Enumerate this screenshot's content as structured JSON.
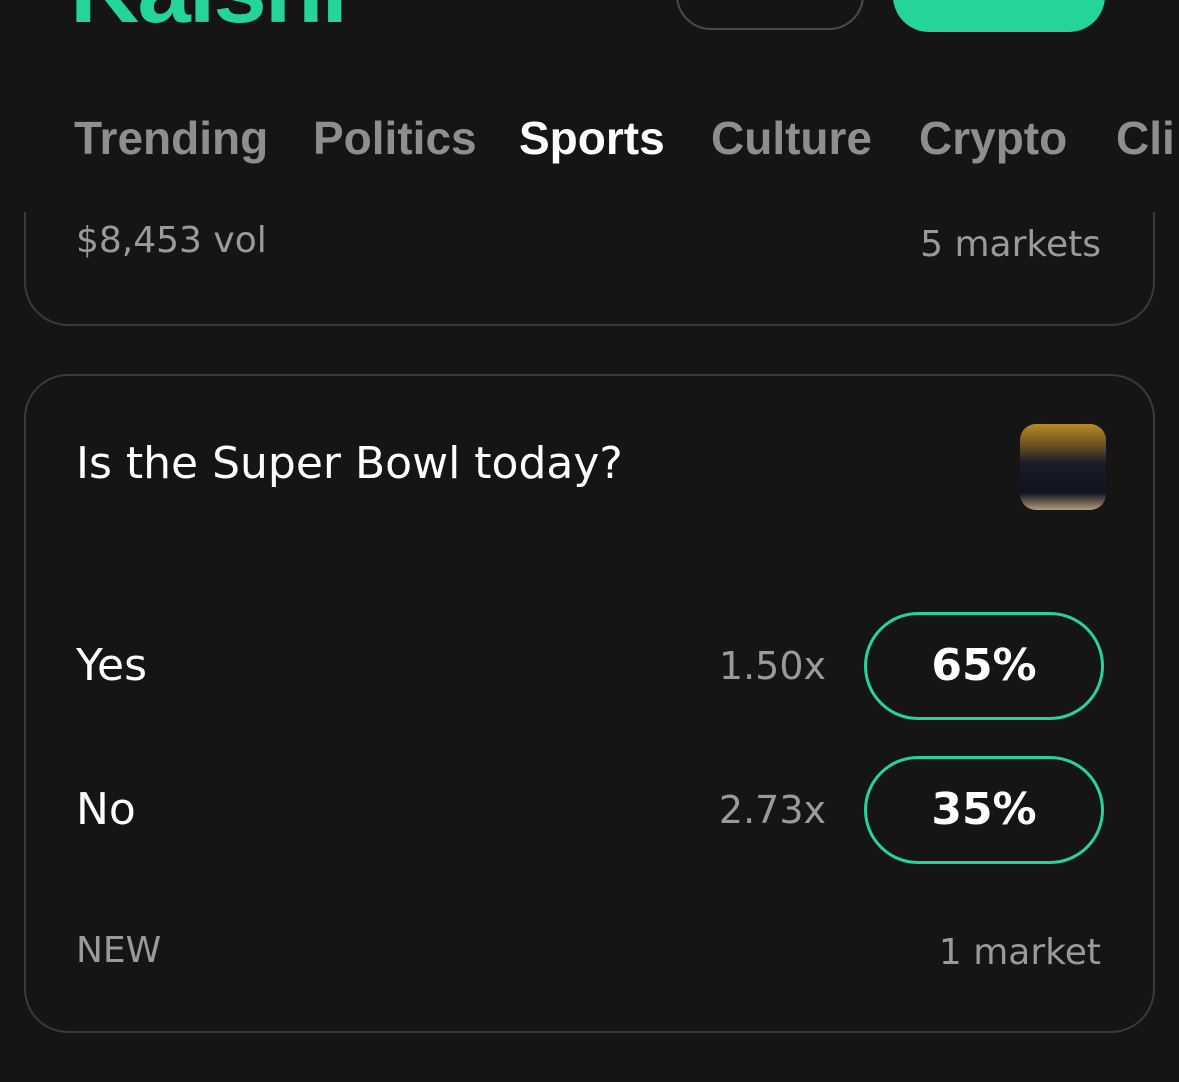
{
  "header": {
    "logo": "Kalshi"
  },
  "nav": {
    "tabs": [
      {
        "label": "Trending",
        "active": false
      },
      {
        "label": "Politics",
        "active": false
      },
      {
        "label": "Sports",
        "active": true
      },
      {
        "label": "Culture",
        "active": false
      },
      {
        "label": "Crypto",
        "active": false
      },
      {
        "label": "Cli",
        "active": false
      }
    ]
  },
  "prev_card": {
    "volume": "$8,453 vol",
    "markets": "5 markets"
  },
  "card": {
    "question": "Is the Super Bowl today?",
    "outcomes": [
      {
        "label": "Yes",
        "multiplier": "1.50x",
        "percent": "65%"
      },
      {
        "label": "No",
        "multiplier": "2.73x",
        "percent": "35%"
      }
    ],
    "status": "NEW",
    "markets": "1 market"
  },
  "colors": {
    "accent": "#25d49b",
    "background": "#151515",
    "border": "#3a3a3a",
    "muted": "#9a9a9a"
  }
}
